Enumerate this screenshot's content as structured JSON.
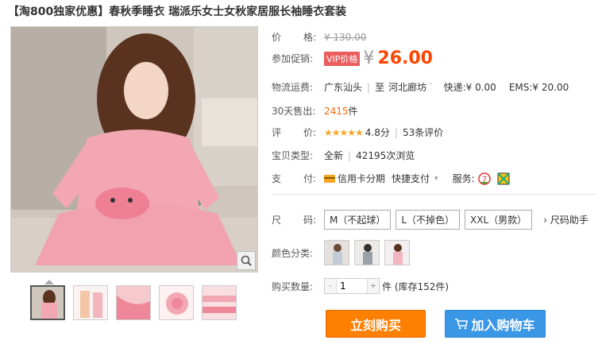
{
  "title": "【淘800独家优惠】春秋季睡衣 瑞派乐女士女秋家居服长袖睡衣套装",
  "price": {
    "label": "价格:",
    "label_chars": [
      "价",
      "格:"
    ],
    "original": "¥ 130.00",
    "promo_label": "参加促销:",
    "vip_tag": "VIP价格",
    "currency": "¥",
    "current": "26.00"
  },
  "shipping": {
    "label": "物流运费:",
    "from": "广东汕头",
    "to_prefix": "至",
    "to": "河北廊坊",
    "express": "快递:¥ 0.00",
    "ems": "EMS:¥ 20.00"
  },
  "sales": {
    "label": "30天售出:",
    "count": "2415",
    "unit": "件"
  },
  "rating": {
    "label_chars": [
      "评",
      "价:"
    ],
    "stars": "★★★★★",
    "score": "4.8分",
    "reviews": "53条评价"
  },
  "item_type": {
    "label": "宝贝类型:",
    "condition": "全新",
    "views": "42195次浏览"
  },
  "payment": {
    "label_chars": [
      "支",
      "付:"
    ],
    "credit": "信用卡分期",
    "quick": "快捷支付",
    "service_label": "服务:"
  },
  "size": {
    "label_chars": [
      "尺",
      "码:"
    ],
    "options": [
      "M（不起球）",
      "L（不掉色）",
      "XXL（男款）"
    ],
    "helper": "尺码助手"
  },
  "color": {
    "label": "颜色分类:"
  },
  "quantity": {
    "label": "购买数量:",
    "value": "1",
    "minus": "-",
    "plus": "+",
    "stock": "件 (库存152件)"
  },
  "actions": {
    "buy_now": "立刻购买",
    "add_to_cart": "加入购物车"
  },
  "colors": {
    "accent_orange": "#ff7f00",
    "price_red": "#ff4400",
    "cart_blue": "#3a97e6",
    "vip_red": "#e95d5d"
  }
}
